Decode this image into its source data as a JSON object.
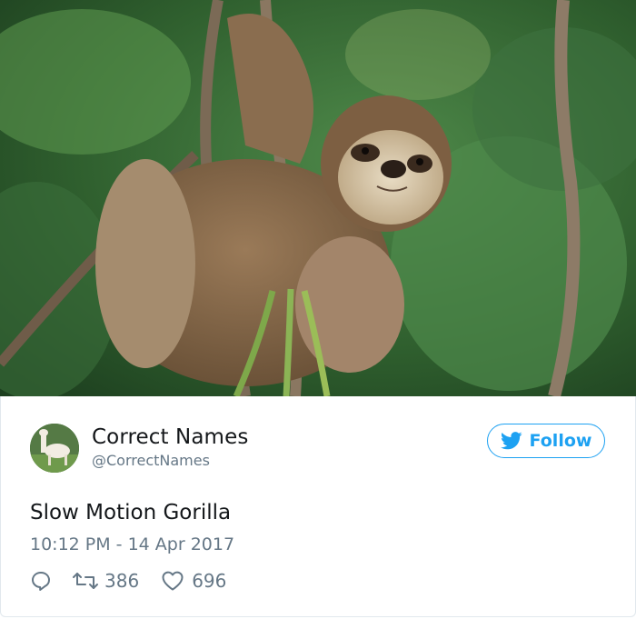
{
  "tweet": {
    "user": {
      "name": "Correct Names",
      "handle": "@CorrectNames"
    },
    "follow_label": "Follow",
    "text": "Slow Motion Gorilla",
    "timestamp": "10:12 PM - 14 Apr 2017",
    "retweets": "386",
    "likes": "696"
  },
  "icons": {
    "reply": "reply-icon",
    "retweet": "retweet-icon",
    "like": "heart-icon",
    "follow": "twitter-bird-icon"
  },
  "colors": {
    "accent": "#1da1f2",
    "text_primary": "#14171a",
    "text_secondary": "#657786",
    "border": "#e1e8ed"
  }
}
